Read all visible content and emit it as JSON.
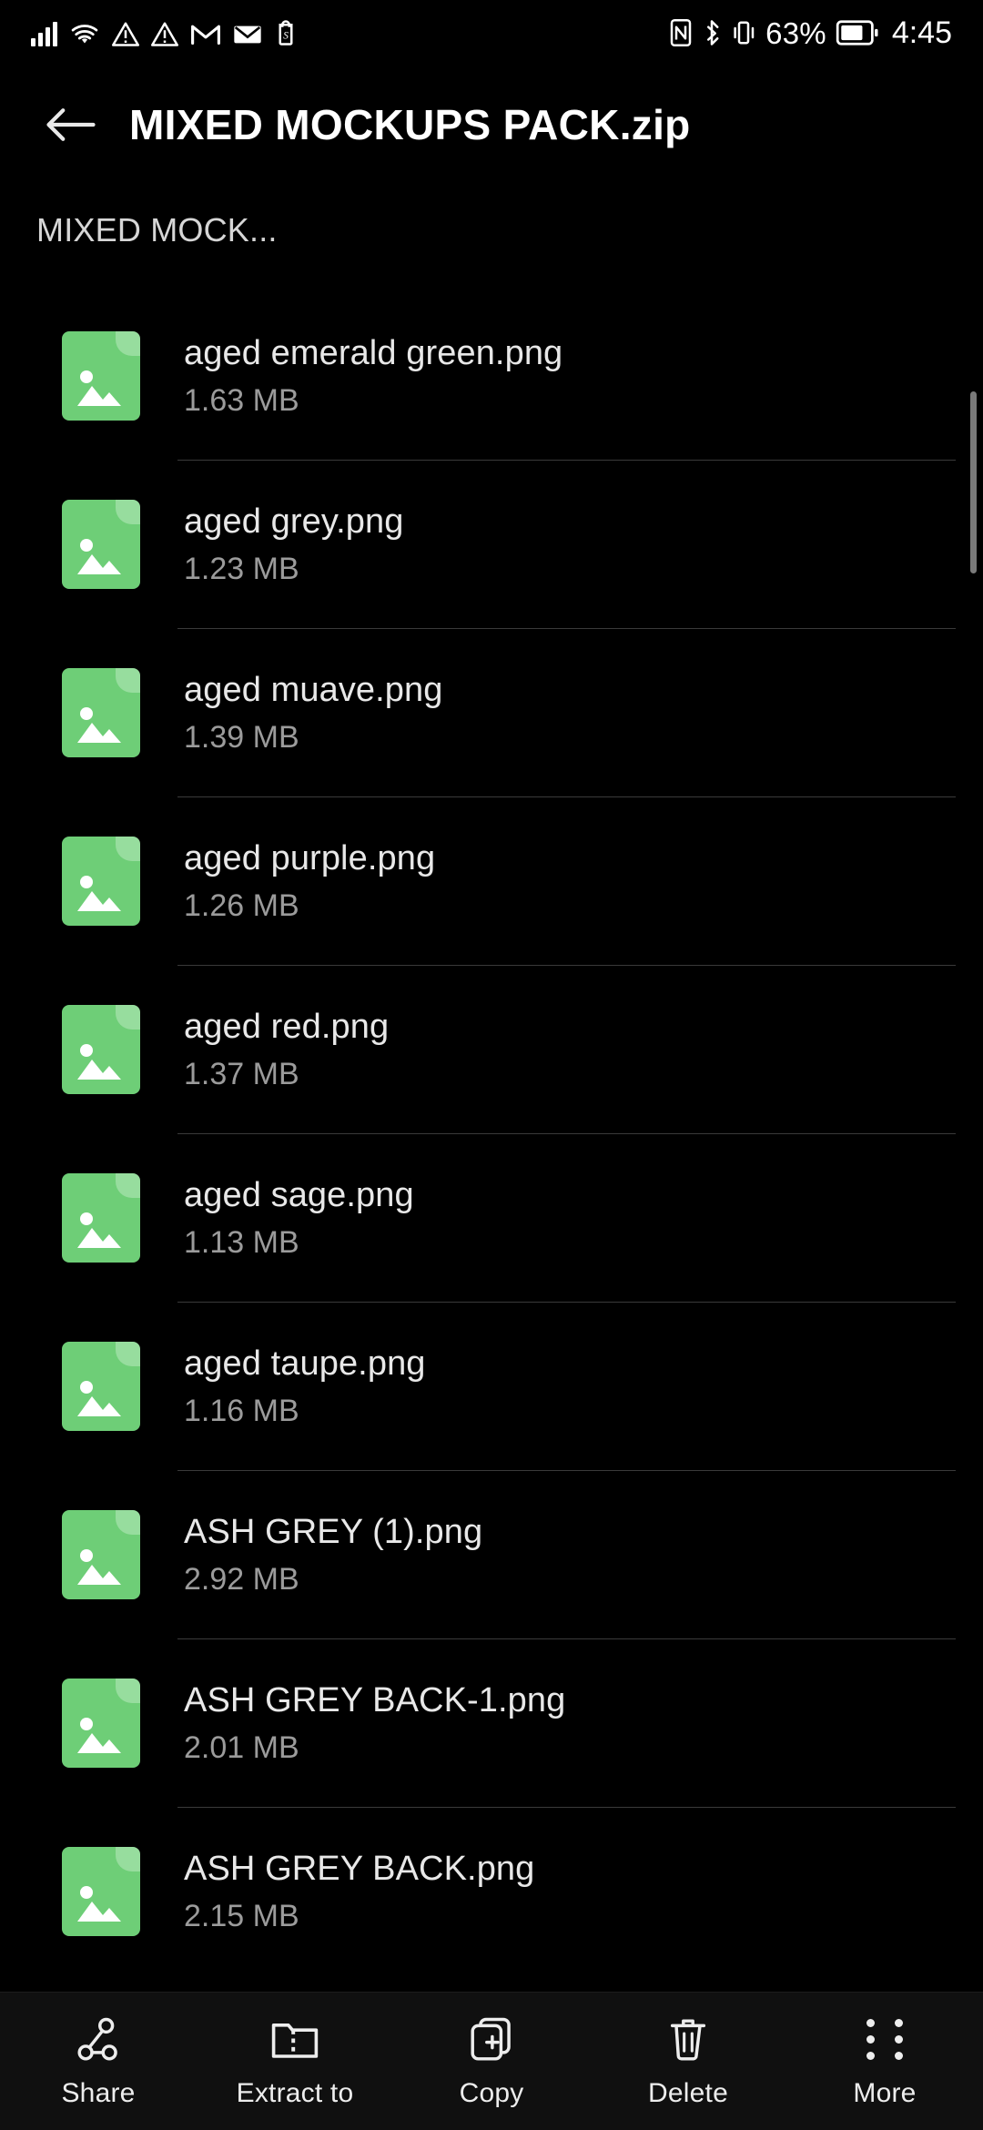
{
  "status_bar": {
    "icons_left": [
      "signal-bars-icon",
      "wifi-icon",
      "warning-triangle-icon",
      "warning-triangle-icon",
      "gmail-icon",
      "email-icon",
      "shopify-icon"
    ],
    "nfc": "nfc-icon",
    "bluetooth": "bluetooth-icon",
    "vibrate": "vibrate-icon",
    "battery_percent": "63%",
    "battery": "battery-icon",
    "time": "4:45"
  },
  "header": {
    "back": "back-arrow-icon",
    "title": "MIXED MOCKUPS PACK.zip"
  },
  "breadcrumb": {
    "path": "MIXED MOCK..."
  },
  "file_list": {
    "items": [
      {
        "name": "aged emerald green.png",
        "size": "1.63 MB",
        "icon": "image-file-icon"
      },
      {
        "name": "aged grey.png",
        "size": "1.23 MB",
        "icon": "image-file-icon"
      },
      {
        "name": "aged muave.png",
        "size": "1.39 MB",
        "icon": "image-file-icon"
      },
      {
        "name": "aged purple.png",
        "size": "1.26 MB",
        "icon": "image-file-icon"
      },
      {
        "name": "aged red.png",
        "size": "1.37 MB",
        "icon": "image-file-icon"
      },
      {
        "name": "aged sage.png",
        "size": "1.13 MB",
        "icon": "image-file-icon"
      },
      {
        "name": "aged taupe.png",
        "size": "1.16 MB",
        "icon": "image-file-icon"
      },
      {
        "name": "ASH GREY (1).png",
        "size": "2.92 MB",
        "icon": "image-file-icon"
      },
      {
        "name": "ASH GREY BACK-1.png",
        "size": "2.01 MB",
        "icon": "image-file-icon"
      },
      {
        "name": "ASH GREY BACK.png",
        "size": "2.15 MB",
        "icon": "image-file-icon"
      }
    ]
  },
  "bottom_bar": {
    "actions": [
      {
        "label": "Share",
        "icon": "share-icon"
      },
      {
        "label": "Extract to",
        "icon": "extract-folder-icon"
      },
      {
        "label": "Copy",
        "icon": "copy-icon"
      },
      {
        "label": "Delete",
        "icon": "trash-icon"
      },
      {
        "label": "More",
        "icon": "more-dots-icon"
      }
    ]
  },
  "colors": {
    "background": "#000000",
    "file_icon_green": "#6ECE77",
    "file_icon_fold": "#97DD9E",
    "primary_text": "#E8E8E8",
    "secondary_text": "#9B9B9B",
    "divider": "#3A3A3A",
    "bottom_bar": "#101010"
  }
}
